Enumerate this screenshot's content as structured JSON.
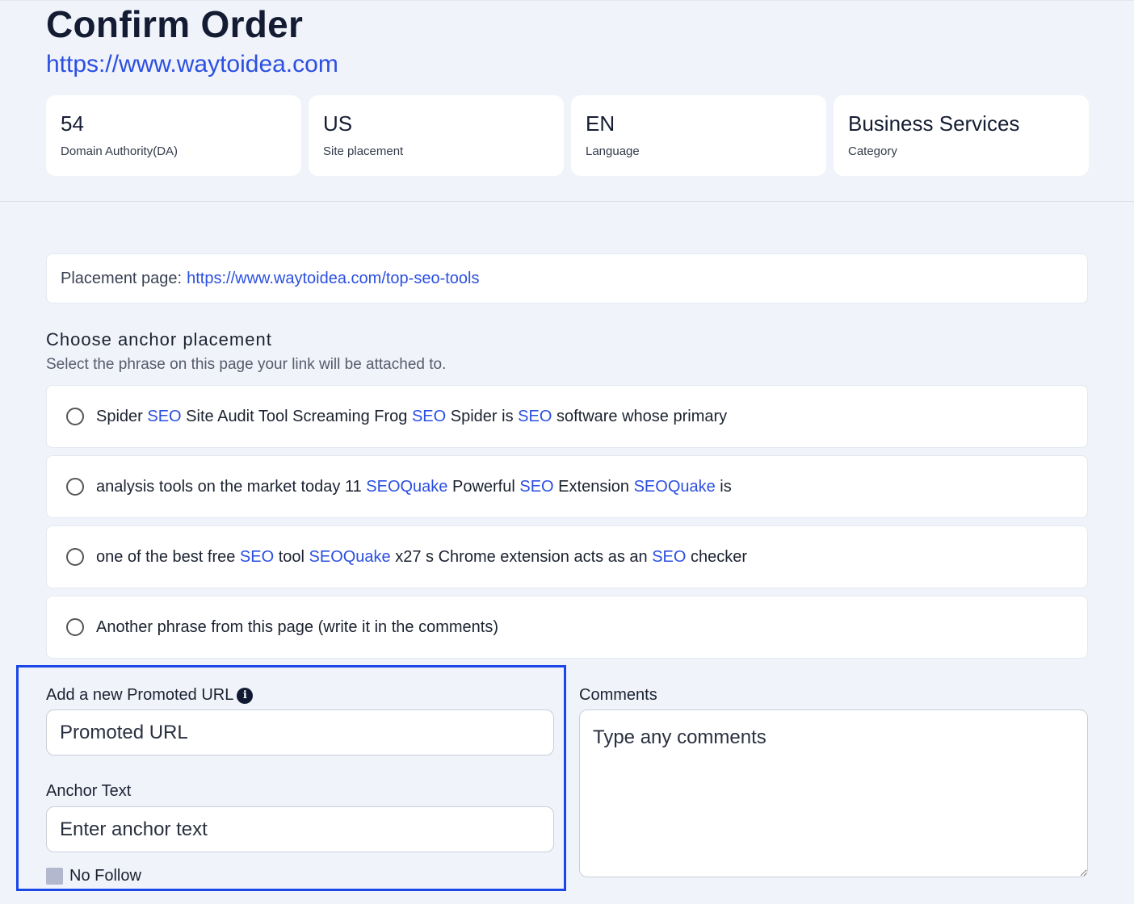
{
  "header": {
    "title": "Confirm Order",
    "site_url": "https://www.waytoidea.com"
  },
  "stats": [
    {
      "value": "54",
      "label": "Domain Authority(DA)"
    },
    {
      "value": "US",
      "label": "Site placement"
    },
    {
      "value": "EN",
      "label": "Language"
    },
    {
      "value": "Business Services",
      "label": "Category"
    }
  ],
  "placement": {
    "label": "Placement page:",
    "url": "https://www.waytoidea.com/top-seo-tools"
  },
  "anchor": {
    "heading": "Choose anchor placement",
    "subheading": "Select the phrase on this page your link will be attached to.",
    "options": [
      [
        {
          "t": "Spider ",
          "h": false
        },
        {
          "t": "SEO",
          "h": true
        },
        {
          "t": " Site Audit Tool Screaming Frog ",
          "h": false
        },
        {
          "t": "SEO",
          "h": true
        },
        {
          "t": " Spider is ",
          "h": false
        },
        {
          "t": "SEO",
          "h": true
        },
        {
          "t": " software whose primary",
          "h": false
        }
      ],
      [
        {
          "t": "analysis tools on the market today 11 ",
          "h": false
        },
        {
          "t": "SEOQuake",
          "h": true
        },
        {
          "t": " Powerful ",
          "h": false
        },
        {
          "t": "SEO",
          "h": true
        },
        {
          "t": " Extension ",
          "h": false
        },
        {
          "t": "SEOQuake",
          "h": true
        },
        {
          "t": " is",
          "h": false
        }
      ],
      [
        {
          "t": "one of the best free ",
          "h": false
        },
        {
          "t": "SEO",
          "h": true
        },
        {
          "t": " tool ",
          "h": false
        },
        {
          "t": "SEOQuake",
          "h": true
        },
        {
          "t": " x27 s Chrome extension acts as an ",
          "h": false
        },
        {
          "t": "SEO",
          "h": true
        },
        {
          "t": " checker",
          "h": false
        }
      ],
      [
        {
          "t": "Another phrase from this page (write it in the comments)",
          "h": false
        }
      ]
    ]
  },
  "form": {
    "promoted_label": "Add a new Promoted URL",
    "promoted_placeholder": "Promoted URL",
    "anchor_label": "Anchor Text",
    "anchor_placeholder": "Enter anchor text",
    "nofollow_label": "No Follow",
    "comments_label": "Comments",
    "comments_placeholder": "Type any comments"
  },
  "icons": {
    "info": "info-icon",
    "radio": "radio-unchecked",
    "checkbox": "checkbox-unchecked"
  },
  "colors": {
    "accent": "#2b4fe0",
    "focus_frame": "#1b47e6",
    "background": "#f0f3fa"
  }
}
